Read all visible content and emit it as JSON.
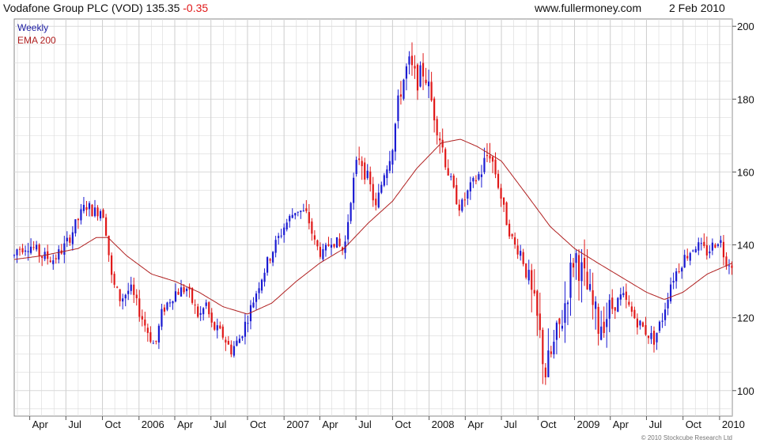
{
  "header": {
    "title": "Vodafone Group PLC (VOD) 135.35",
    "change": "-0.35",
    "site": "www.fullermoney.com",
    "date": "2 Feb 2010"
  },
  "legend": {
    "period": "Weekly",
    "ema": "EMA 200"
  },
  "credit": "© 2010 Stockcube Research Ltd",
  "colors": {
    "up": "#1a1ad2",
    "down": "#e01818",
    "ema": "#b02020",
    "grid": "#d9d9d9",
    "period_text": "#1a1aa0",
    "ema_text": "#b02020",
    "change_text": "#e01818"
  },
  "chart_data": {
    "type": "candlestick",
    "x_range": [
      "2005-02-21",
      "2010-02-02"
    ],
    "ylim": [
      93,
      202
    ],
    "y_ticks": [
      100,
      120,
      140,
      160,
      180,
      200
    ],
    "x_ticks": [
      {
        "label": "Apr",
        "date": "2005-04-01"
      },
      {
        "label": "Jul",
        "date": "2005-07-01"
      },
      {
        "label": "Oct",
        "date": "2005-10-01"
      },
      {
        "label": "2006",
        "date": "2006-01-01"
      },
      {
        "label": "Apr",
        "date": "2006-04-01"
      },
      {
        "label": "Jul",
        "date": "2006-07-01"
      },
      {
        "label": "Oct",
        "date": "2006-10-01"
      },
      {
        "label": "2007",
        "date": "2007-01-01"
      },
      {
        "label": "Apr",
        "date": "2007-04-01"
      },
      {
        "label": "Jul",
        "date": "2007-07-01"
      },
      {
        "label": "Oct",
        "date": "2007-10-01"
      },
      {
        "label": "2008",
        "date": "2008-01-01"
      },
      {
        "label": "Apr",
        "date": "2008-04-01"
      },
      {
        "label": "Jul",
        "date": "2008-07-01"
      },
      {
        "label": "Oct",
        "date": "2008-10-01"
      },
      {
        "label": "2009",
        "date": "2009-01-01"
      },
      {
        "label": "Apr",
        "date": "2009-04-01"
      },
      {
        "label": "Jul",
        "date": "2009-07-01"
      },
      {
        "label": "Oct",
        "date": "2009-10-01"
      },
      {
        "label": "2010",
        "date": "2010-01-01"
      }
    ],
    "price_path": [
      [
        "2005-02-21",
        137
      ],
      [
        "2005-03-01",
        139
      ],
      [
        "2005-04-01",
        140
      ],
      [
        "2005-05-01",
        137
      ],
      [
        "2005-06-01",
        136
      ],
      [
        "2005-07-01",
        140
      ],
      [
        "2005-08-01",
        147
      ],
      [
        "2005-08-20",
        151
      ],
      [
        "2005-09-10",
        149
      ],
      [
        "2005-10-01",
        150
      ],
      [
        "2005-10-10",
        144
      ],
      [
        "2005-10-25",
        130
      ],
      [
        "2005-11-15",
        125
      ],
      [
        "2005-12-10",
        128
      ],
      [
        "2006-01-01",
        122
      ],
      [
        "2006-01-20",
        117
      ],
      [
        "2006-02-10",
        112
      ],
      [
        "2006-03-01",
        122
      ],
      [
        "2006-04-01",
        127
      ],
      [
        "2006-05-01",
        128
      ],
      [
        "2006-06-01",
        120
      ],
      [
        "2006-06-20",
        124
      ],
      [
        "2006-07-01",
        118
      ],
      [
        "2006-08-01",
        115
      ],
      [
        "2006-08-20",
        111
      ],
      [
        "2006-09-10",
        114
      ],
      [
        "2006-10-01",
        120
      ],
      [
        "2006-11-01",
        130
      ],
      [
        "2006-12-01",
        138
      ],
      [
        "2007-01-01",
        145
      ],
      [
        "2007-02-01",
        150
      ],
      [
        "2007-03-01",
        148
      ],
      [
        "2007-03-20",
        140
      ],
      [
        "2007-04-10",
        137
      ],
      [
        "2007-05-01",
        142
      ],
      [
        "2007-06-01",
        138
      ],
      [
        "2007-06-20",
        155
      ],
      [
        "2007-07-10",
        165
      ],
      [
        "2007-08-01",
        158
      ],
      [
        "2007-08-20",
        150
      ],
      [
        "2007-09-10",
        160
      ],
      [
        "2007-10-01",
        168
      ],
      [
        "2007-10-20",
        182
      ],
      [
        "2007-11-10",
        190
      ],
      [
        "2007-12-01",
        185
      ],
      [
        "2007-12-20",
        188
      ],
      [
        "2008-01-10",
        178
      ],
      [
        "2008-02-01",
        168
      ],
      [
        "2008-03-01",
        155
      ],
      [
        "2008-03-20",
        150
      ],
      [
        "2008-04-10",
        155
      ],
      [
        "2008-05-10",
        160
      ],
      [
        "2008-06-01",
        166
      ],
      [
        "2008-06-20",
        158
      ],
      [
        "2008-07-10",
        148
      ],
      [
        "2008-08-01",
        140
      ],
      [
        "2008-08-20",
        138
      ],
      [
        "2008-09-10",
        128
      ],
      [
        "2008-10-01",
        118
      ],
      [
        "2008-10-20",
        105
      ],
      [
        "2008-11-10",
        112
      ],
      [
        "2008-12-01",
        120
      ],
      [
        "2009-01-01",
        138
      ],
      [
        "2009-01-20",
        132
      ],
      [
        "2009-02-10",
        125
      ],
      [
        "2009-03-01",
        118
      ],
      [
        "2009-04-01",
        122
      ],
      [
        "2009-05-01",
        126
      ],
      [
        "2009-06-01",
        120
      ],
      [
        "2009-07-01",
        116
      ],
      [
        "2009-07-20",
        114
      ],
      [
        "2009-08-10",
        120
      ],
      [
        "2009-09-01",
        130
      ],
      [
        "2009-10-01",
        136
      ],
      [
        "2009-11-01",
        140
      ],
      [
        "2009-12-01",
        138
      ],
      [
        "2010-01-01",
        142
      ],
      [
        "2010-01-15",
        136
      ],
      [
        "2010-02-02",
        135
      ]
    ],
    "ema_200": [
      [
        "2005-02-21",
        136
      ],
      [
        "2005-05-01",
        137
      ],
      [
        "2005-08-01",
        139
      ],
      [
        "2005-09-15",
        142
      ],
      [
        "2005-10-15",
        142
      ],
      [
        "2005-12-01",
        137
      ],
      [
        "2006-02-01",
        132
      ],
      [
        "2006-04-01",
        130
      ],
      [
        "2006-06-01",
        127
      ],
      [
        "2006-08-01",
        123
      ],
      [
        "2006-10-01",
        121
      ],
      [
        "2006-12-01",
        124
      ],
      [
        "2007-02-01",
        130
      ],
      [
        "2007-04-01",
        135
      ],
      [
        "2007-06-01",
        139
      ],
      [
        "2007-08-01",
        146
      ],
      [
        "2007-10-01",
        152
      ],
      [
        "2007-12-01",
        161
      ],
      [
        "2008-02-01",
        168
      ],
      [
        "2008-03-20",
        169
      ],
      [
        "2008-05-01",
        167
      ],
      [
        "2008-07-01",
        163
      ],
      [
        "2008-09-01",
        154
      ],
      [
        "2008-11-01",
        145
      ],
      [
        "2009-01-01",
        139
      ],
      [
        "2009-03-01",
        135
      ],
      [
        "2009-05-01",
        131
      ],
      [
        "2009-07-01",
        127
      ],
      [
        "2009-08-15",
        125
      ],
      [
        "2009-10-01",
        127
      ],
      [
        "2009-12-01",
        132
      ],
      [
        "2010-02-02",
        135
      ]
    ]
  }
}
